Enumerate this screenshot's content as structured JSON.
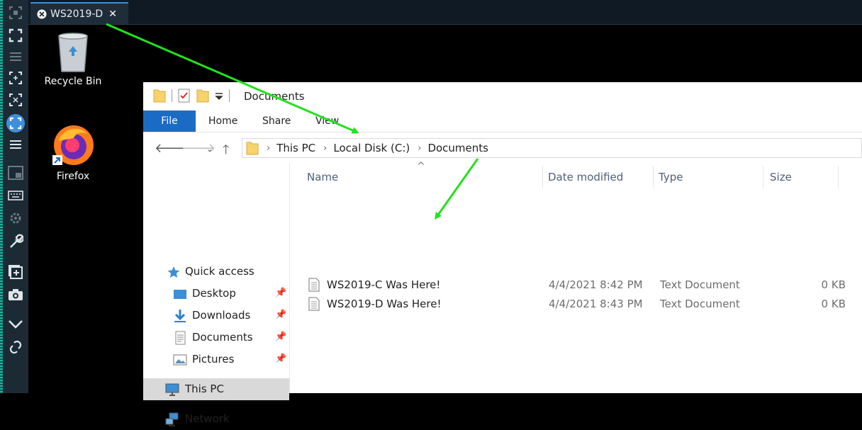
{
  "colors": {
    "accent": "#1a6bc4",
    "arrow": "#22e21e",
    "toolbar_bg": "#1c2a35",
    "selected_row": "#d9d9d9"
  },
  "tab": {
    "title": "WS2019-D",
    "close_glyph": "✕"
  },
  "desktop": {
    "icons": [
      {
        "label": "Recycle Bin",
        "icon": "recycle-bin-icon"
      },
      {
        "label": "Firefox",
        "icon": "firefox-icon"
      }
    ]
  },
  "explorer": {
    "title": "Documents",
    "ribbon_tabs": [
      "File",
      "Home",
      "Share",
      "View"
    ],
    "breadcrumb": [
      "This PC",
      "Local Disk (C:)",
      "Documents"
    ],
    "nav": [
      {
        "label": "Quick access",
        "icon": "star-icon"
      },
      {
        "label": "Desktop",
        "icon": "desktop-folder-icon",
        "pinned": true
      },
      {
        "label": "Downloads",
        "icon": "download-arrow-icon",
        "pinned": true
      },
      {
        "label": "Documents",
        "icon": "documents-folder-icon",
        "pinned": true
      },
      {
        "label": "Pictures",
        "icon": "pictures-folder-icon",
        "pinned": true
      },
      {
        "label": "This PC",
        "icon": "computer-icon",
        "selected": true
      },
      {
        "label": "Network",
        "icon": "network-icon"
      }
    ],
    "columns": [
      "Name",
      "Date modified",
      "Type",
      "Size"
    ],
    "files": [
      {
        "name": "WS2019-C Was Here!",
        "date": "4/4/2021 8:42 PM",
        "type": "Text Document",
        "size": "0 KB"
      },
      {
        "name": "WS2019-D Was Here!",
        "date": "4/4/2021 8:43 PM",
        "type": "Text Document",
        "size": "0 KB"
      }
    ]
  }
}
